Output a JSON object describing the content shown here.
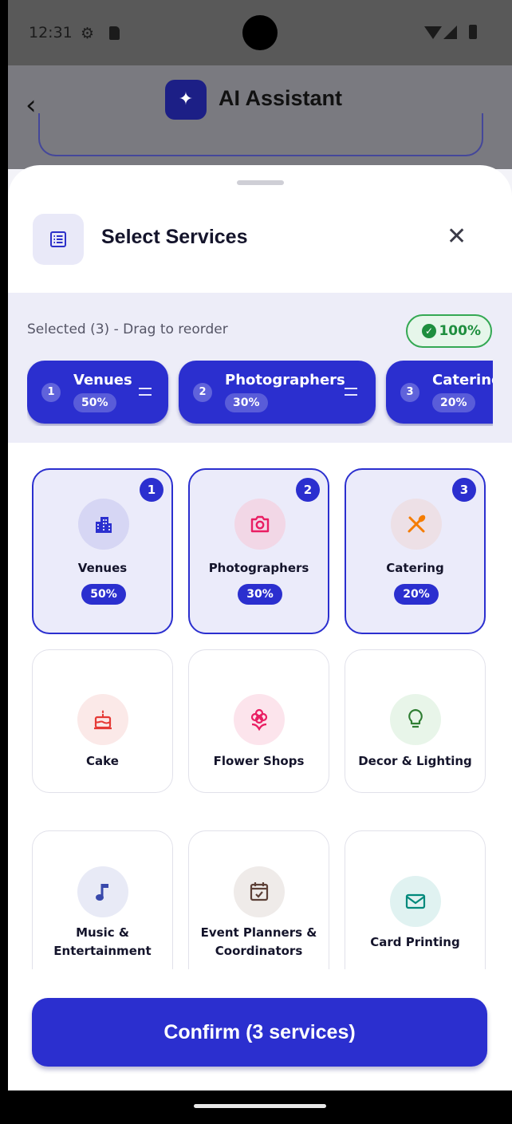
{
  "status_bar": {
    "time": "12:31"
  },
  "app_bar": {
    "back_icon": "chevron-left-icon",
    "logo_icon": "sparkle-icon",
    "title": "AI Assistant"
  },
  "sheet": {
    "title": "Select Services",
    "header_icon": "list-icon",
    "close_icon": "close-icon",
    "selected_label": "Selected (3) - Drag to reorder",
    "total_percent": "100%",
    "total_color": "#1e8e3e",
    "selected_chips": [
      {
        "number": "1",
        "name": "Venues",
        "percent": "50%"
      },
      {
        "number": "2",
        "name": "Photographers",
        "percent": "30%"
      },
      {
        "number": "3",
        "name": "Catering",
        "percent": "20%"
      }
    ],
    "services": [
      {
        "name": "Venues",
        "icon": "building-icon",
        "selected": true,
        "order": "1",
        "percent": "50%",
        "icon_color": "#2b2fcf",
        "icon_bg": "#d6d6f4"
      },
      {
        "name": "Photographers",
        "icon": "camera-icon",
        "selected": true,
        "order": "2",
        "percent": "30%",
        "icon_color": "#e91e63",
        "icon_bg": "#f2d7e6"
      },
      {
        "name": "Catering",
        "icon": "fork-knife-icon",
        "selected": true,
        "order": "3",
        "percent": "20%",
        "icon_color": "#f57c00",
        "icon_bg": "#ede0e6"
      },
      {
        "name": "Cake",
        "icon": "cake-icon",
        "selected": false,
        "icon_color": "#e53935",
        "icon_bg": "#fbe9e8"
      },
      {
        "name": "Flower Shops",
        "icon": "flower-icon",
        "selected": false,
        "icon_color": "#e91e63",
        "icon_bg": "#fce4ec"
      },
      {
        "name": "Decor & Lighting",
        "icon": "lightbulb-icon",
        "selected": false,
        "icon_color": "#2e7d32",
        "icon_bg": "#e8f5e9"
      },
      {
        "name": "Music & Entertainment",
        "icon": "music-note-icon",
        "selected": false,
        "icon_color": "#3949ab",
        "icon_bg": "#e8eaf6"
      },
      {
        "name": "Event Planners & Coordinators",
        "icon": "calendar-check-icon",
        "selected": false,
        "icon_color": "#5d4037",
        "icon_bg": "#efebe9"
      },
      {
        "name": "Card Printing",
        "icon": "mail-icon",
        "selected": false,
        "icon_color": "#00897b",
        "icon_bg": "#e0f2f1"
      }
    ],
    "confirm_label": "Confirm (3 services)",
    "accent_color": "#2b2fcf"
  }
}
